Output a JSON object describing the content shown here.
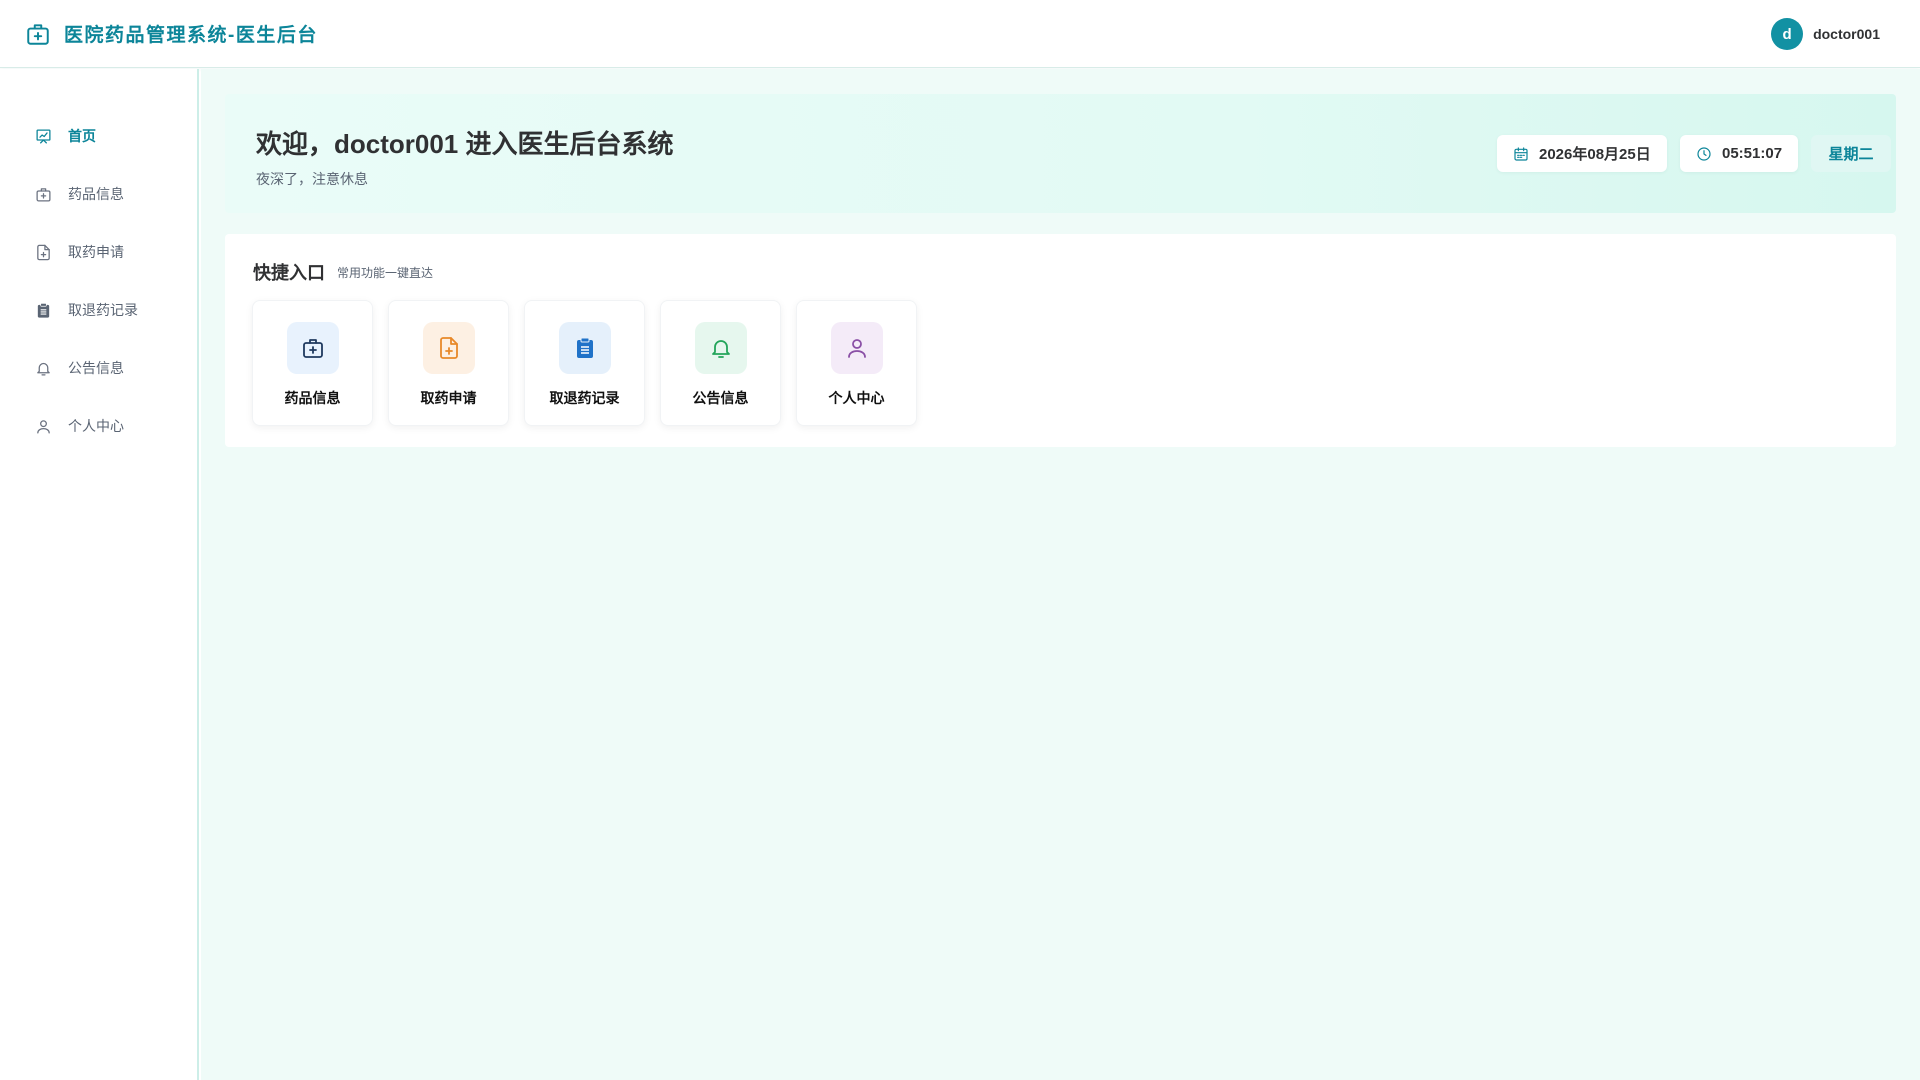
{
  "header": {
    "title": "医院药品管理系统-医生后台",
    "brand_icon": "medical-kit-icon",
    "user": {
      "avatar_letter": "d",
      "name": "doctor001"
    }
  },
  "sidebar": {
    "items": [
      {
        "label": "首页",
        "icon": "dashboard-chart-icon",
        "active": true
      },
      {
        "label": "药品信息",
        "icon": "medical-kit-icon",
        "active": false
      },
      {
        "label": "取药申请",
        "icon": "document-plus-icon",
        "active": false
      },
      {
        "label": "取退药记录",
        "icon": "clipboard-icon",
        "active": false
      },
      {
        "label": "公告信息",
        "icon": "bell-icon",
        "active": false
      },
      {
        "label": "个人中心",
        "icon": "user-icon",
        "active": false
      }
    ]
  },
  "welcome": {
    "title": "欢迎，doctor001 进入医生后台系统",
    "subtitle": "夜深了，注意休息",
    "date": "2026年08月25日",
    "time": "05:51:07",
    "weekday": "星期二"
  },
  "quick": {
    "title": "快捷入口",
    "subtitle": "常用功能一键直达",
    "cards": [
      {
        "label": "药品信息",
        "icon": "medical-kit-icon",
        "bg": "#e8f2fd",
        "color": "#1f3a5f"
      },
      {
        "label": "取药申请",
        "icon": "document-plus-icon",
        "bg": "#fdf0e3",
        "color": "#e8892a"
      },
      {
        "label": "取退药记录",
        "icon": "clipboard-icon",
        "bg": "#e5f0fb",
        "color": "#1f72c8"
      },
      {
        "label": "公告信息",
        "icon": "bell-icon",
        "bg": "#e6f7ee",
        "color": "#23a55a"
      },
      {
        "label": "个人中心",
        "icon": "user-icon",
        "bg": "#f4ebf8",
        "color": "#8a4fa6"
      }
    ]
  },
  "colors": {
    "accent": "#0c8599",
    "main_bg": "#effbf8"
  }
}
